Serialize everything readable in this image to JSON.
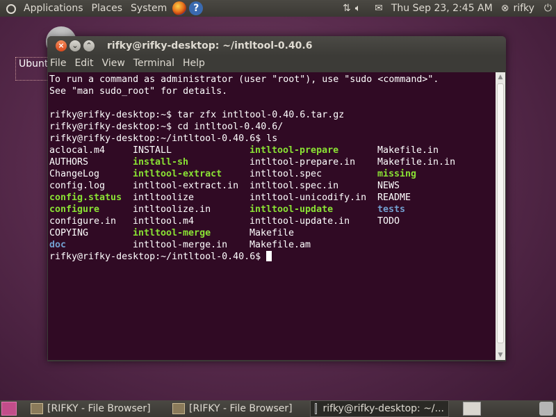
{
  "top_panel": {
    "menus": [
      "Applications",
      "Places",
      "System"
    ],
    "clock": "Thu Sep 23,  2:45 AM",
    "user": "rifky",
    "icons": [
      "ubuntu-logo-icon",
      "firefox-icon",
      "help-icon",
      "network-icon",
      "volume-icon",
      "mail-icon",
      "user-status-icon",
      "power-icon"
    ]
  },
  "desktop": {
    "icon_label": "Ubuntu"
  },
  "window": {
    "title": "rifky@rifky-desktop: ~/intltool-0.40.6",
    "menu": [
      "File",
      "Edit",
      "View",
      "Terminal",
      "Help"
    ]
  },
  "terminal": {
    "lines": [
      "To run a command as administrator (user \"root\"), use \"sudo <command>\".",
      "See \"man sudo_root\" for details.",
      "",
      "rifky@rifky-desktop:~$ tar zfx intltool-0.40.6.tar.gz",
      "rifky@rifky-desktop:~$ cd intltool-0.40.6/",
      "rifky@rifky-desktop:~/intltool-0.40.6$ ls"
    ],
    "ls_rows": [
      [
        [
          "aclocal.m4",
          "f"
        ],
        [
          "INSTALL",
          "f"
        ],
        [
          "intltool-prepare",
          "x"
        ],
        [
          "Makefile.in",
          "f"
        ]
      ],
      [
        [
          "AUTHORS",
          "f"
        ],
        [
          "install-sh",
          "x"
        ],
        [
          "intltool-prepare.in",
          "f"
        ],
        [
          "Makefile.in.in",
          "f"
        ]
      ],
      [
        [
          "ChangeLog",
          "f"
        ],
        [
          "intltool-extract",
          "x"
        ],
        [
          "intltool.spec",
          "f"
        ],
        [
          "missing",
          "x"
        ]
      ],
      [
        [
          "config.log",
          "f"
        ],
        [
          "intltool-extract.in",
          "f"
        ],
        [
          "intltool.spec.in",
          "f"
        ],
        [
          "NEWS",
          "f"
        ]
      ],
      [
        [
          "config.status",
          "x"
        ],
        [
          "intltoolize",
          "f"
        ],
        [
          "intltool-unicodify.in",
          "f"
        ],
        [
          "README",
          "f"
        ]
      ],
      [
        [
          "configure",
          "x"
        ],
        [
          "intltoolize.in",
          "f"
        ],
        [
          "intltool-update",
          "x"
        ],
        [
          "tests",
          "d"
        ]
      ],
      [
        [
          "configure.in",
          "f"
        ],
        [
          "intltool.m4",
          "f"
        ],
        [
          "intltool-update.in",
          "f"
        ],
        [
          "TODO",
          "f"
        ]
      ],
      [
        [
          "COPYING",
          "f"
        ],
        [
          "intltool-merge",
          "x"
        ],
        [
          "Makefile",
          "f"
        ],
        [
          "",
          ""
        ]
      ],
      [
        [
          "doc",
          "d"
        ],
        [
          "intltool-merge.in",
          "f"
        ],
        [
          "Makefile.am",
          "f"
        ],
        [
          "",
          ""
        ]
      ]
    ],
    "prompt": "rifky@rifky-desktop:~/intltool-0.40.6$ "
  },
  "taskbar": {
    "tasks": [
      "[RIFKY - File Browser]",
      "[RIFKY - File Browser]",
      "rifky@rifky-desktop: ~/..."
    ]
  },
  "colors": {
    "terminal_bg": "#300a24",
    "executable": "#8ae234",
    "directory": "#729fcf"
  }
}
